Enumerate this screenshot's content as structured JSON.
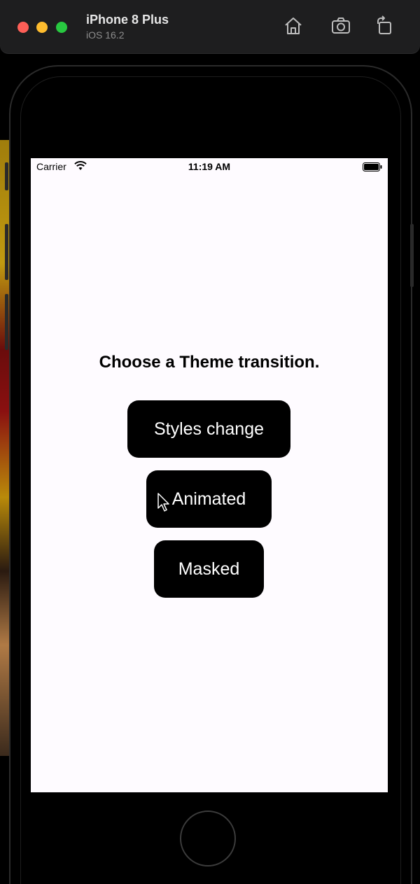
{
  "window": {
    "device_name": "iPhone 8 Plus",
    "os_version": "iOS 16.2",
    "toolbar": {
      "home_icon": "home-icon",
      "screenshot_icon": "camera-icon",
      "rotate_icon": "rotate-icon"
    },
    "traffic_lights": {
      "close": "#fe5f57",
      "minimize": "#febc2e",
      "zoom": "#28c840"
    }
  },
  "status_bar": {
    "carrier": "Carrier",
    "time": "11:19 AM",
    "wifi_icon": "wifi-icon",
    "battery_icon": "battery-icon"
  },
  "screen": {
    "prompt": "Choose a Theme transition.",
    "buttons": [
      {
        "label": "Styles change"
      },
      {
        "label": "Animated"
      },
      {
        "label": "Masked"
      }
    ],
    "button_color": "#000000",
    "button_text_color": "#ffffff",
    "background": "#fefbff"
  }
}
